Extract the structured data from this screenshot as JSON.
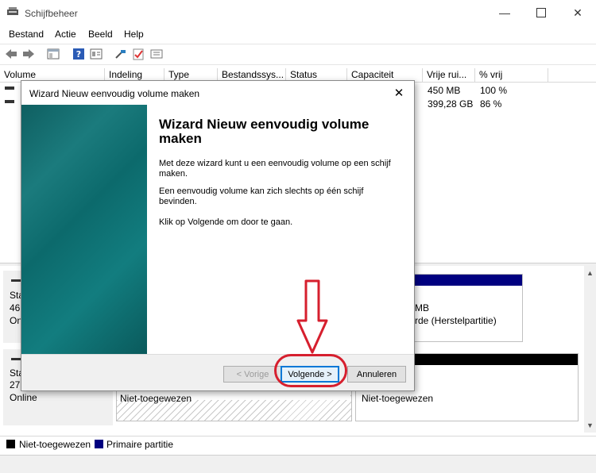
{
  "window": {
    "title": "Schijfbeheer",
    "minimize_icon": "minimize-icon",
    "maximize_icon": "maximize-icon",
    "close_icon": "close-icon"
  },
  "menu": [
    "Bestand",
    "Actie",
    "Beeld",
    "Help"
  ],
  "toolbar_icons": [
    "back-arrow-icon",
    "forward-arrow-icon",
    "console-tree-icon",
    "help-icon",
    "properties-icon",
    "connect-icon",
    "checklist-icon",
    "disk-list-icon"
  ],
  "volume_list": {
    "columns": [
      "Volume",
      "Indeling",
      "Type",
      "Bestandssys...",
      "Status",
      "Capaciteit",
      "Vrije rui...",
      "% vrij"
    ],
    "rows": [
      {
        "vrij": "450 MB",
        "pct": "100 %"
      },
      {
        "vrij": "399,28 GB",
        "pct": "86 %"
      }
    ]
  },
  "disks": [
    {
      "status_partial": "Sta",
      "size_partial": "46",
      "online_partial": "Onl",
      "right_line1": "MB",
      "right_line2": "rde (Herstelpartitie)"
    },
    {
      "status_partial": "Sta",
      "size_partial": "27",
      "online": "Online",
      "unallocated_left": "Niet-toegewezen",
      "unallocated_right": "Niet-toegewezen"
    }
  ],
  "legend": [
    {
      "label": "Niet-toegewezen",
      "color": "#000000"
    },
    {
      "label": "Primaire partitie",
      "color": "#000080"
    }
  ],
  "dialog": {
    "title": "Wizard Nieuw eenvoudig volume maken",
    "heading": "Wizard Nieuw eenvoudig volume maken",
    "p1": "Met deze wizard kunt u een eenvoudig volume op een schijf maken.",
    "p2": "Een eenvoudig volume kan zich slechts op één schijf bevinden.",
    "p3": "Klik op Volgende om door te gaan.",
    "back_label": "< Vorige",
    "next_label": "Volgende >",
    "cancel_label": "Annuleren"
  },
  "colors": {
    "annotation": "#d61f2e",
    "primary_partition": "#000080",
    "wizard_side": "#0f6a6c"
  }
}
